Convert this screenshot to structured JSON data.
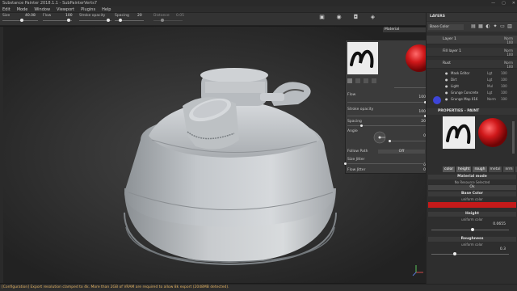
{
  "window": {
    "title": "Substance Painter 2018.1.1 - SubPainterVerts7",
    "controls": [
      "—",
      "▢",
      "✕"
    ]
  },
  "menu": [
    "Edit",
    "Mode",
    "Window",
    "Viewport",
    "Plugins",
    "Help"
  ],
  "toolbar": {
    "size_label": "Size",
    "size_value": "40.08",
    "flow_label": "Flow",
    "flow_value": "100",
    "stroke_opacity_label": "Stroke opacity",
    "stroke_opacity_value": "100",
    "spacing_label": "Spacing",
    "spacing_value": "20",
    "distance_label": "Distance",
    "distance_value": "0.05",
    "sliders": {
      "size": 0.55,
      "flow": 0.9,
      "stroke_opacity": 0.9,
      "spacing": 0.2,
      "distance": 0.3
    }
  },
  "viewport": {
    "mode": "Material"
  },
  "brush_popup": {
    "flow_label": "Flow",
    "flow_value": "100",
    "stroke_opacity_label": "Stroke opacity",
    "stroke_opacity_value": "100",
    "spacing_label": "Spacing",
    "spacing_value": "20",
    "angle_label": "Angle",
    "angle_value": "0",
    "follow_path_label": "Follow Path",
    "follow_path_value": "Off",
    "size_jitter_label": "Size Jitter",
    "size_jitter_value": "0",
    "flow_jitter_label": "Flow Jitter",
    "flow_jitter_value": "0",
    "sliders": {
      "flow": 1.0,
      "stroke_opacity": 1.0,
      "spacing": 0.2,
      "angle": 0.0,
      "size_jitter": 0.0,
      "flow_jitter": 0.0
    }
  },
  "layers_panel": {
    "title": "LAYERS",
    "channel_dropdown": "Base Color",
    "layers": [
      {
        "name": "Layer 1",
        "blend": "Norm",
        "opacity": "100"
      },
      {
        "name": "Fill layer 1",
        "blend": "Norm",
        "opacity": "100"
      },
      {
        "name": "Rust",
        "blend": "Norm",
        "opacity": "100"
      }
    ],
    "sub_channels": [
      {
        "name": "Mask Editor",
        "blend": "Lgt",
        "opacity": "100"
      },
      {
        "name": "Dirt",
        "blend": "Lgt",
        "opacity": "100"
      },
      {
        "name": "Light",
        "blend": "Mul",
        "opacity": "100"
      },
      {
        "name": "Grunge Concrete",
        "blend": "Lgt",
        "opacity": "100"
      },
      {
        "name": "Grunge Map 016",
        "blend": "Norm",
        "opacity": "100"
      }
    ]
  },
  "properties_panel": {
    "title": "PROPERTIES - PAINT",
    "channels": [
      "color",
      "height",
      "rough",
      "metal",
      "nrm",
      "ao"
    ],
    "material_mode_title": "Material mode",
    "material_mode_sub": "No Resource Selected",
    "ok_label": "Ok",
    "base_color_title": "Base Color",
    "base_color_sub": "uniform color",
    "base_color_hex": "#c41a1a",
    "height_title": "Height",
    "height_sub": "uniform color",
    "height_value": "0.0655",
    "roughness_title": "Roughness",
    "roughness_sub": "uniform color",
    "roughness_value": "0.3",
    "sliders": {
      "height": 0.53,
      "roughness": 0.3
    }
  },
  "status": {
    "message": "[Configuration] Export resolution clamped to 4k. More than 2GB of VRAM are required to allow 8k export (2048MB detected)."
  }
}
